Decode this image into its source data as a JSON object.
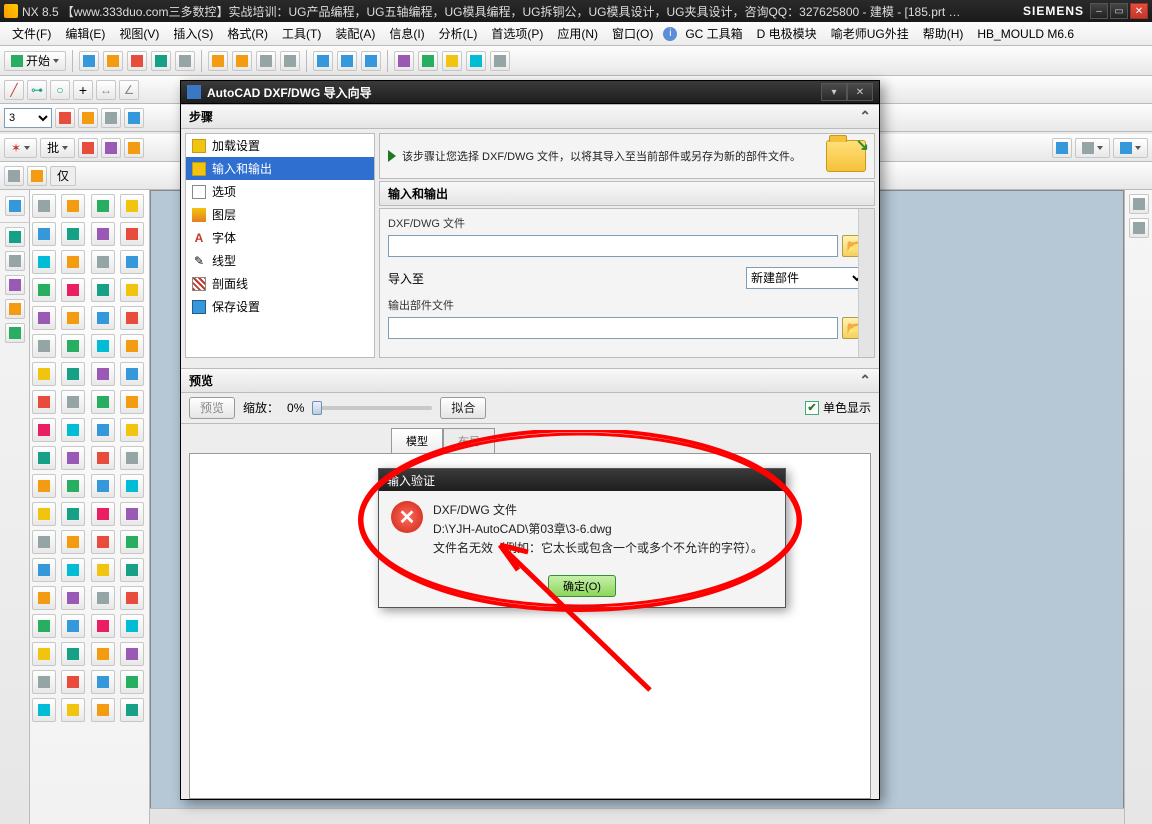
{
  "titlebar": {
    "app": "NX 8.5",
    "desc": "【www.333duo.com三多数控】实战培训：UG产品编程，UG五轴编程，UG模具编程，UG拆铜公，UG模具设计，UG夹具设计，咨询QQ：327625800 - 建模 - [185.prt …",
    "brand": "SIEMENS"
  },
  "menus": [
    "文件(F)",
    "编辑(E)",
    "视图(V)",
    "插入(S)",
    "格式(R)",
    "工具(T)",
    "装配(A)",
    "信息(I)",
    "分析(L)",
    "首选项(P)",
    "应用(N)",
    "窗口(O)",
    "GC 工具箱",
    "D 电极模块",
    "喻老师UG外挂",
    "帮助(H)",
    "HB_MOULD M6.6"
  ],
  "toolbar1": {
    "start": "开始"
  },
  "row3": {
    "batch": "批",
    "only": "仅"
  },
  "numsel": "3",
  "dialog": {
    "title": "AutoCAD DXF/DWG 导入向导",
    "steps_head": "步骤",
    "steps": [
      "加载设置",
      "输入和输出",
      "选项",
      "图层",
      "字体",
      "线型",
      "剖面线",
      "保存设置"
    ],
    "sel_step_index": 1,
    "desc": "该步骤让您选择 DXF/DWG 文件，以将其导入至当前部件或另存为新的部件文件。",
    "io_head": "输入和输出",
    "file_label": "DXF/DWG 文件",
    "import_to": "导入至",
    "import_to_value": "新建部件",
    "out_file_label": "输出部件文件",
    "preview_head": "预览",
    "preview_btn": "预览",
    "zoom_label": "缩放：",
    "zoom_val": "0%",
    "fit_btn": "拟合",
    "mono_chk": "单色显示",
    "tab_model": "模型",
    "tab_layout": "布局"
  },
  "error": {
    "title": "输入验证",
    "line1": "DXF/DWG 文件",
    "line2": "D:\\YJH-AutoCAD\\第03章\\3-6.dwg",
    "line3": "文件名无效（例如：它太长或包含一个或多个不允许的字符）。",
    "ok": "确定(O)"
  }
}
